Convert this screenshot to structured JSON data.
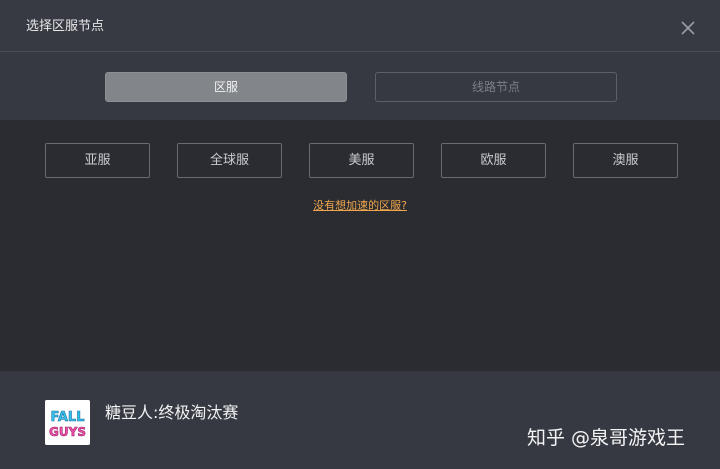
{
  "dialog": {
    "title": "选择区服节点"
  },
  "tabs": [
    {
      "label": "区服",
      "active": true
    },
    {
      "label": "线路节点",
      "active": false
    }
  ],
  "regions": [
    "亚服",
    "全球服",
    "美服",
    "欧服",
    "澳服"
  ],
  "help_link": "没有想加速的区服?",
  "game": {
    "name": "糖豆人:终极淘汰赛",
    "icon": "fall-guys-logo",
    "icon_text_top": "FALL",
    "icon_text_bottom": "GUYS"
  },
  "watermark": "知乎 @泉哥游戏王",
  "colors": {
    "accent_link": "#f0a64b",
    "active_tab": "#828589",
    "background": "#2a2c32",
    "panel": "#363941"
  }
}
